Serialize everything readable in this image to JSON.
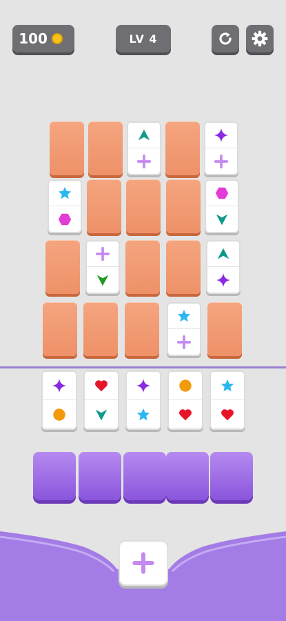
{
  "hud": {
    "coins": "100",
    "level": "LV 4"
  },
  "colors": {
    "purple": "#8a2be2",
    "teal": "#0e9a8a",
    "lavender": "#c58af0",
    "sky": "#2cb7f0",
    "magenta": "#e23bd6",
    "green": "#1e9a1e",
    "red": "#e6152a",
    "orange": "#f39a0c"
  },
  "board": [
    [
      {
        "type": "back"
      },
      {
        "type": "back"
      },
      {
        "type": "face",
        "top": {
          "shape": "triangle-up",
          "color": "teal"
        },
        "bottom": {
          "shape": "plus",
          "color": "lavender"
        }
      },
      {
        "type": "back"
      },
      {
        "type": "face",
        "top": {
          "shape": "sparkle",
          "color": "purple"
        },
        "bottom": {
          "shape": "plus",
          "color": "lavender"
        }
      }
    ],
    [
      {
        "type": "face",
        "top": {
          "shape": "star",
          "color": "sky"
        },
        "bottom": {
          "shape": "hexagon",
          "color": "magenta"
        }
      },
      {
        "type": "back"
      },
      {
        "type": "back"
      },
      {
        "type": "back"
      },
      {
        "type": "face",
        "top": {
          "shape": "hexagon",
          "color": "magenta"
        },
        "bottom": {
          "shape": "triangle-down",
          "color": "teal"
        }
      }
    ],
    [
      {
        "type": "back"
      },
      {
        "type": "face",
        "top": {
          "shape": "plus",
          "color": "lavender"
        },
        "bottom": {
          "shape": "triangle-down",
          "color": "green"
        }
      },
      {
        "type": "back"
      },
      {
        "type": "back"
      },
      {
        "type": "face",
        "top": {
          "shape": "triangle-up",
          "color": "teal"
        },
        "bottom": {
          "shape": "sparkle",
          "color": "purple"
        }
      }
    ],
    [
      {
        "type": "back"
      },
      {
        "type": "back"
      },
      {
        "type": "back"
      },
      {
        "type": "face",
        "top": {
          "shape": "star",
          "color": "sky"
        },
        "bottom": {
          "shape": "plus",
          "color": "lavender"
        }
      },
      {
        "type": "back"
      }
    ]
  ],
  "hand": [
    {
      "top": {
        "shape": "sparkle",
        "color": "purple"
      },
      "bottom": {
        "shape": "circle",
        "color": "orange"
      }
    },
    {
      "top": {
        "shape": "heart",
        "color": "red"
      },
      "bottom": {
        "shape": "triangle-down",
        "color": "teal"
      }
    },
    {
      "top": {
        "shape": "sparkle",
        "color": "purple"
      },
      "bottom": {
        "shape": "star",
        "color": "sky"
      }
    },
    {
      "top": {
        "shape": "circle",
        "color": "orange"
      },
      "bottom": {
        "shape": "heart",
        "color": "red"
      }
    },
    {
      "top": {
        "shape": "star",
        "color": "sky"
      },
      "bottom": {
        "shape": "heart",
        "color": "red"
      }
    }
  ],
  "slots_count": 5,
  "add_button_icon": "plus-icon"
}
